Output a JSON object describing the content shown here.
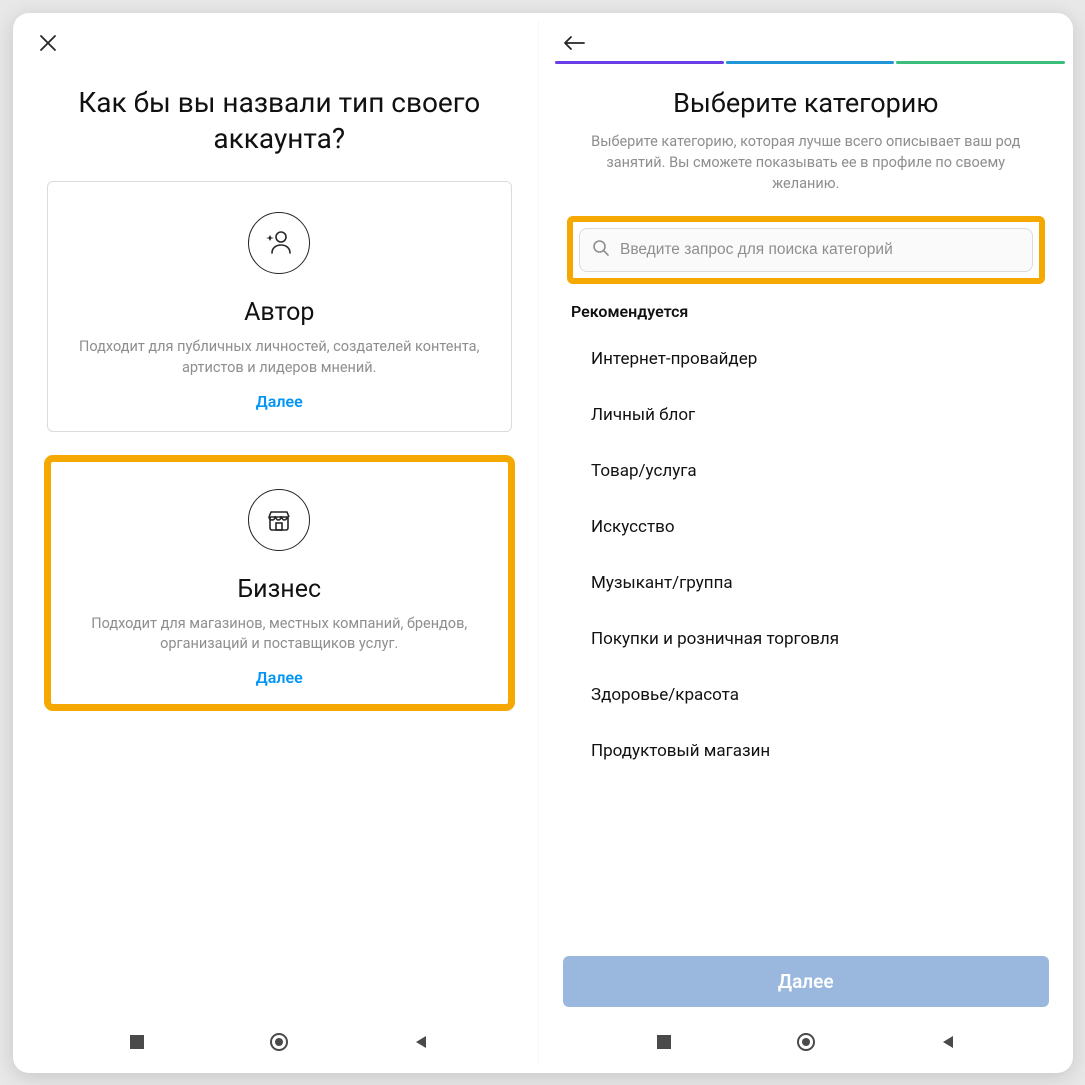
{
  "left": {
    "title": "Как бы вы назвали тип своего аккаунта?",
    "cards": [
      {
        "icon": "creator-icon",
        "title": "Автор",
        "desc": "Подходит для публичных личностей, создателей контента, артистов и лидеров мнений.",
        "cta": "Далее",
        "highlight": false
      },
      {
        "icon": "business-icon",
        "title": "Бизнес",
        "desc": "Подходит для магазинов, местных компаний, брендов, организаций и поставщиков услуг.",
        "cta": "Далее",
        "highlight": true
      }
    ]
  },
  "right": {
    "title": "Выберите категорию",
    "subtitle": "Выберите категорию, которая лучше всего описывает ваш род занятий. Вы сможете показывать ее в профиле по своему желанию.",
    "search_placeholder": "Введите запрос для поиска категорий",
    "recommended_label": "Рекомендуется",
    "categories": [
      "Интернет-провайдер",
      "Личный блог",
      "Товар/услуга",
      "Искусство",
      "Музыкант/группа",
      "Покупки и розничная торговля",
      "Здоровье/красота",
      "Продуктовый магазин"
    ],
    "cta": "Далее",
    "progress_colors": [
      "#6a3de8",
      "#2196d6",
      "#3bbf7a"
    ]
  },
  "highlight_color": "#f5a900"
}
